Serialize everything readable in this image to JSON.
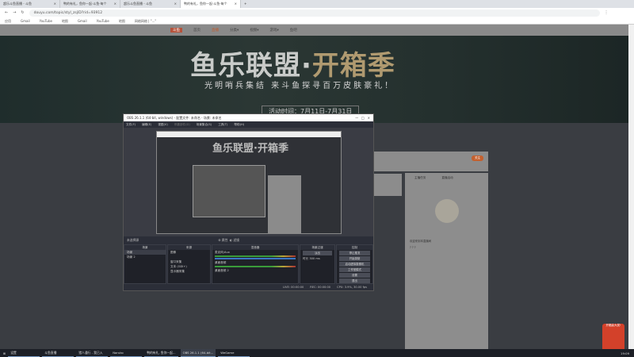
{
  "browser": {
    "tabs": [
      "超乐斗鱼直播 - 斗鱼",
      "鸭的有礼，鱼你一起·斗鱼·每个",
      "超乐斗鱼直播 - 斗鱼",
      "鸭的有礼，鱼你一起·斗鱼·每个"
    ],
    "new_tab": "+",
    "url": "douyu.com/topic/styl_zsjlD?rid=93912",
    "bookmarks": [
      "应用",
      "Gmail",
      "YouTube",
      "地图",
      "Gmail",
      "YouTube",
      "地图",
      "网络网络 | \"...\""
    ]
  },
  "site": {
    "nav": [
      "首页",
      "直播",
      "分类▾",
      "视频▾",
      "游戏▾",
      "鱼吧"
    ],
    "banner_title_a": "鱼乐联盟·",
    "banner_title_b": "开箱季",
    "banner_sub": "光明哨兵集结 来斗鱼探寻百万皮肤豪礼！",
    "banner_date": "活动时间：7月11日-7月31日",
    "chat_tabs": [
      "主播任务",
      "直播活动"
    ],
    "chat_msgs": [
      "欢迎来到本直播间",
      "? ? ?"
    ],
    "follow": "关注",
    "gift": "开箱赢大奖!"
  },
  "obs": {
    "title": "OBS 26.1.1 (64-bit, windows) - 配置文件: 未命名 - 场景: 未命名",
    "menu": [
      "文件(F)",
      "编辑(E)",
      "视图(V)",
      "停靠部件(D)",
      "场景集合(S)",
      "工具(T)",
      "帮助(H)"
    ],
    "capture_title": "鱼乐联盟·开箱季",
    "no_source": "未选择源",
    "props": "⚙ 属性",
    "filters": "◐ 滤镜",
    "docks": {
      "scenes": "场景",
      "sources": "来源",
      "mixer": "混音器",
      "transitions": "场景过渡",
      "controls": "控制"
    },
    "scenes": [
      "场景",
      "场景 2"
    ],
    "sources": [
      "图像",
      "",
      "窗口采集",
      "文本 (GDI+)",
      "显示器采集"
    ],
    "mixer": [
      "麦克风/Aux",
      "桌面音频",
      "桌面音频 2"
    ],
    "transition": "淡出",
    "duration_label": "时长",
    "duration": "300 ms",
    "controls": [
      "停止推流",
      "开始录制",
      "启动虚拟摄像机",
      "工作室模式",
      "设置",
      "退出"
    ],
    "status": {
      "live": "LIVE: 00:00:00",
      "rec": "REC: 00:00:00",
      "cpu": "CPU: 3.9%, 30.00 fps"
    }
  },
  "taskbar": {
    "items": [
      "设置",
      "斗鱼直播",
      "猎人通行 - 我已入",
      "Naruko",
      "鸭的有礼, 鱼你一起...",
      "OBS 26.1.1 (64-bit...",
      "WeGame"
    ],
    "clock": "19:09"
  }
}
